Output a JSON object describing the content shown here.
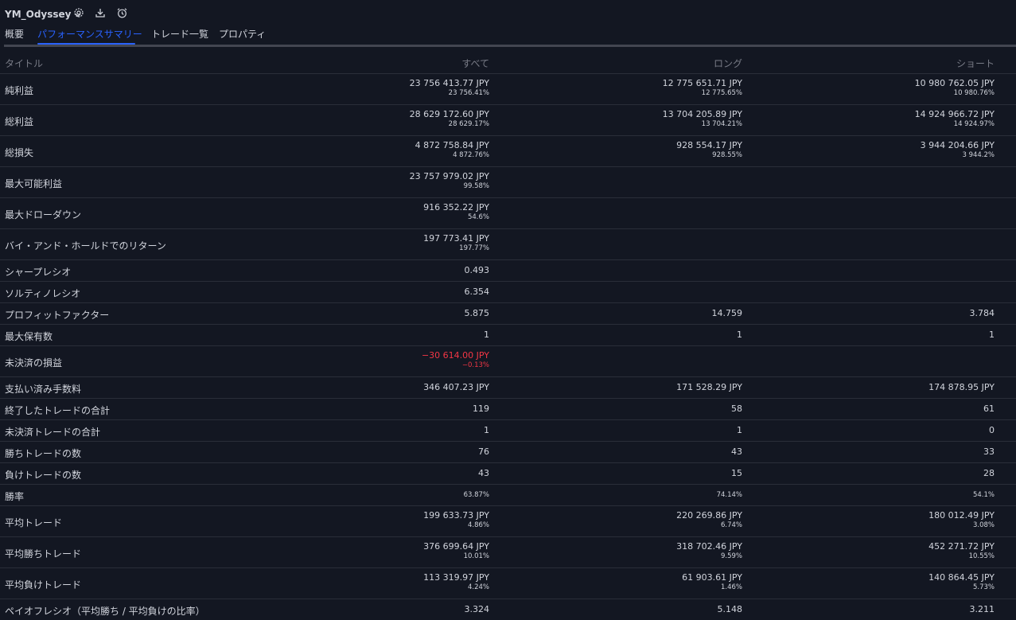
{
  "header": {
    "strategy_name": "YM_Odyssey"
  },
  "icons": {
    "dropdown": "chevron-down-icon",
    "settings": "gear-icon",
    "download": "download-icon",
    "alarm": "alarm-clock-icon"
  },
  "tabs": [
    {
      "label": "概要",
      "active": false
    },
    {
      "label": "パフォーマンスサマリー",
      "active": true
    },
    {
      "label": "トレード一覧",
      "active": false
    },
    {
      "label": "プロパティ",
      "active": false
    }
  ],
  "colors": {
    "background": "#131722",
    "accent": "#2962ff",
    "negative": "#f23645",
    "text": "#d1d4dc",
    "muted": "#787b86"
  },
  "table": {
    "headers": [
      "タイトル",
      "すべて",
      "ロング",
      "ショート"
    ],
    "rows": [
      {
        "title": "純利益",
        "all": {
          "v": "23 756 413.77 JPY",
          "p": "23 756.41%"
        },
        "long": {
          "v": "12 775 651.71 JPY",
          "p": "12 775.65%"
        },
        "short": {
          "v": "10 980 762.05 JPY",
          "p": "10 980.76%"
        }
      },
      {
        "title": "総利益",
        "all": {
          "v": "28 629 172.60 JPY",
          "p": "28 629.17%"
        },
        "long": {
          "v": "13 704 205.89 JPY",
          "p": "13 704.21%"
        },
        "short": {
          "v": "14 924 966.72 JPY",
          "p": "14 924.97%"
        }
      },
      {
        "title": "総損失",
        "all": {
          "v": "4 872 758.84 JPY",
          "p": "4 872.76%"
        },
        "long": {
          "v": "928 554.17 JPY",
          "p": "928.55%"
        },
        "short": {
          "v": "3 944 204.66 JPY",
          "p": "3 944.2%"
        }
      },
      {
        "title": "最大可能利益",
        "all": {
          "v": "23 757 979.02 JPY",
          "p": "99.58%"
        }
      },
      {
        "title": "最大ドローダウン",
        "all": {
          "v": "916 352.22 JPY",
          "p": "54.6%"
        }
      },
      {
        "title": "バイ・アンド・ホールドでのリターン",
        "all": {
          "v": "197 773.41 JPY",
          "p": "197.77%"
        }
      },
      {
        "title": "シャープレシオ",
        "all": {
          "v": "0.493"
        }
      },
      {
        "title": "ソルティノレシオ",
        "all": {
          "v": "6.354"
        }
      },
      {
        "title": "プロフィットファクター",
        "all": {
          "v": "5.875"
        },
        "long": {
          "v": "14.759"
        },
        "short": {
          "v": "3.784"
        }
      },
      {
        "title": "最大保有数",
        "all": {
          "v": "1"
        },
        "long": {
          "v": "1"
        },
        "short": {
          "v": "1"
        }
      },
      {
        "title": "未決済の損益",
        "all": {
          "v": "−30 614.00 JPY",
          "p": "−0.13%",
          "negative": true
        }
      },
      {
        "title": "支払い済み手数料",
        "all": {
          "v": "346 407.23 JPY"
        },
        "long": {
          "v": "171 528.29 JPY"
        },
        "short": {
          "v": "174 878.95 JPY"
        }
      },
      {
        "title": "終了したトレードの合計",
        "all": {
          "v": "119"
        },
        "long": {
          "v": "58"
        },
        "short": {
          "v": "61"
        }
      },
      {
        "title": "未決済トレードの合計",
        "all": {
          "v": "1"
        },
        "long": {
          "v": "1"
        },
        "short": {
          "v": "0"
        }
      },
      {
        "title": "勝ちトレードの数",
        "all": {
          "v": "76"
        },
        "long": {
          "v": "43"
        },
        "short": {
          "v": "33"
        }
      },
      {
        "title": "負けトレードの数",
        "all": {
          "v": "43"
        },
        "long": {
          "v": "15"
        },
        "short": {
          "v": "28"
        }
      },
      {
        "title": "勝率",
        "all": {
          "v": "63.87%",
          "small": true
        },
        "long": {
          "v": "74.14%",
          "small": true
        },
        "short": {
          "v": "54.1%",
          "small": true
        }
      },
      {
        "title": "平均トレード",
        "all": {
          "v": "199 633.73 JPY",
          "p": "4.86%"
        },
        "long": {
          "v": "220 269.86 JPY",
          "p": "6.74%"
        },
        "short": {
          "v": "180 012.49 JPY",
          "p": "3.08%"
        }
      },
      {
        "title": "平均勝ちトレード",
        "all": {
          "v": "376 699.64 JPY",
          "p": "10.01%"
        },
        "long": {
          "v": "318 702.46 JPY",
          "p": "9.59%"
        },
        "short": {
          "v": "452 271.72 JPY",
          "p": "10.55%"
        }
      },
      {
        "title": "平均負けトレード",
        "all": {
          "v": "113 319.97 JPY",
          "p": "4.24%"
        },
        "long": {
          "v": "61 903.61 JPY",
          "p": "1.46%"
        },
        "short": {
          "v": "140 864.45 JPY",
          "p": "5.73%"
        }
      },
      {
        "title": "ペイオフレシオ（平均勝ち / 平均負けの比率）",
        "all": {
          "v": "3.324"
        },
        "long": {
          "v": "5.148"
        },
        "short": {
          "v": "3.211"
        }
      }
    ]
  }
}
